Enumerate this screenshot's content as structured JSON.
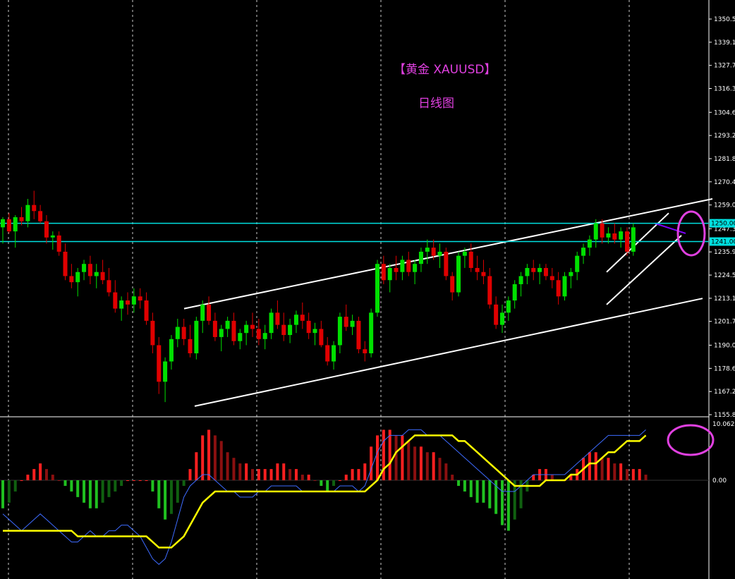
{
  "chart_data": {
    "type": "candlestick",
    "title": "【黄金 XAUUSD】",
    "subtitle": "日线图",
    "price_axis": {
      "labels": [
        "1350.50",
        "1339.10",
        "1327.70",
        "1316.30",
        "1304.60",
        "1293.20",
        "1281.80",
        "1270.40",
        "1259.00",
        "1247.30",
        "1235.90",
        "1224.50",
        "1213.10",
        "1201.70",
        "1190.00",
        "1178.60",
        "1167.20",
        "1155.80"
      ],
      "range": [
        1155.8,
        1350.5
      ]
    },
    "horizontal_levels": [
      {
        "value": 1250.0,
        "label": "1250.00",
        "color": "#00e0e0"
      },
      {
        "value": 1241.0,
        "label": "1241.00",
        "color": "#00e0e0"
      }
    ],
    "trend_channel": {
      "lower": [
        [
          276,
          1160
        ],
        [
          996,
          1213
        ]
      ],
      "upper": [
        [
          261,
          1208
        ],
        [
          1010,
          1262
        ]
      ]
    },
    "small_channel": {
      "lower": [
        [
          860,
          1210
        ],
        [
          966,
          1244
        ]
      ],
      "upper": [
        [
          860,
          1226
        ],
        [
          948,
          1255
        ]
      ]
    },
    "highlight_circles": [
      "price-latest",
      "macd-latest"
    ],
    "candles": [
      [
        1248,
        1253,
        1240,
        1252
      ],
      [
        1252,
        1255,
        1245,
        1246
      ],
      [
        1246,
        1254,
        1238,
        1253
      ],
      [
        1253,
        1258,
        1249,
        1251
      ],
      [
        1251,
        1262,
        1248,
        1259
      ],
      [
        1259,
        1266,
        1252,
        1256
      ],
      [
        1256,
        1259,
        1250,
        1251
      ],
      [
        1251,
        1254,
        1240,
        1243
      ],
      [
        1243,
        1246,
        1237,
        1244
      ],
      [
        1244,
        1246,
        1234,
        1236
      ],
      [
        1236,
        1240,
        1222,
        1224
      ],
      [
        1224,
        1230,
        1218,
        1221
      ],
      [
        1221,
        1228,
        1214,
        1226
      ],
      [
        1226,
        1232,
        1222,
        1230
      ],
      [
        1230,
        1234,
        1220,
        1224
      ],
      [
        1224,
        1230,
        1218,
        1226
      ],
      [
        1226,
        1232,
        1220,
        1222
      ],
      [
        1222,
        1228,
        1214,
        1216
      ],
      [
        1216,
        1222,
        1206,
        1208
      ],
      [
        1208,
        1214,
        1202,
        1212
      ],
      [
        1212,
        1216,
        1205,
        1210
      ],
      [
        1210,
        1218,
        1206,
        1214
      ],
      [
        1214,
        1218,
        1208,
        1212
      ],
      [
        1212,
        1216,
        1200,
        1202
      ],
      [
        1202,
        1206,
        1186,
        1190
      ],
      [
        1190,
        1194,
        1166,
        1172
      ],
      [
        1172,
        1184,
        1162,
        1182
      ],
      [
        1182,
        1195,
        1178,
        1193
      ],
      [
        1193,
        1203,
        1189,
        1199
      ],
      [
        1199,
        1203,
        1190,
        1193
      ],
      [
        1193,
        1200,
        1184,
        1186
      ],
      [
        1186,
        1204,
        1183,
        1202
      ],
      [
        1202,
        1212,
        1196,
        1210
      ],
      [
        1210,
        1214,
        1200,
        1202
      ],
      [
        1202,
        1206,
        1192,
        1194
      ],
      [
        1194,
        1200,
        1187,
        1198
      ],
      [
        1198,
        1204,
        1194,
        1202
      ],
      [
        1202,
        1206,
        1190,
        1192
      ],
      [
        1192,
        1198,
        1188,
        1196
      ],
      [
        1196,
        1202,
        1190,
        1200
      ],
      [
        1200,
        1206,
        1194,
        1198
      ],
      [
        1198,
        1203,
        1190,
        1193
      ],
      [
        1193,
        1200,
        1188,
        1196
      ],
      [
        1196,
        1208,
        1193,
        1206
      ],
      [
        1206,
        1212,
        1198,
        1200
      ],
      [
        1200,
        1206,
        1192,
        1195
      ],
      [
        1195,
        1203,
        1191,
        1200
      ],
      [
        1200,
        1207,
        1196,
        1205
      ],
      [
        1205,
        1211,
        1198,
        1202
      ],
      [
        1202,
        1206,
        1193,
        1196
      ],
      [
        1196,
        1201,
        1190,
        1198
      ],
      [
        1198,
        1202,
        1189,
        1190
      ],
      [
        1190,
        1194,
        1180,
        1182
      ],
      [
        1182,
        1192,
        1178,
        1190
      ],
      [
        1190,
        1206,
        1186,
        1204
      ],
      [
        1204,
        1210,
        1197,
        1199
      ],
      [
        1199,
        1205,
        1195,
        1202
      ],
      [
        1202,
        1204,
        1186,
        1188
      ],
      [
        1188,
        1192,
        1182,
        1186
      ],
      [
        1186,
        1208,
        1184,
        1206
      ],
      [
        1206,
        1232,
        1204,
        1230
      ],
      [
        1230,
        1234,
        1220,
        1222
      ],
      [
        1222,
        1230,
        1216,
        1228
      ],
      [
        1228,
        1234,
        1222,
        1226
      ],
      [
        1226,
        1234,
        1222,
        1232
      ],
      [
        1232,
        1236,
        1224,
        1226
      ],
      [
        1226,
        1232,
        1220,
        1230
      ],
      [
        1230,
        1238,
        1226,
        1236
      ],
      [
        1236,
        1242,
        1230,
        1238
      ],
      [
        1238,
        1242,
        1232,
        1234
      ],
      [
        1234,
        1240,
        1228,
        1236
      ],
      [
        1236,
        1238,
        1222,
        1224
      ],
      [
        1224,
        1226,
        1212,
        1216
      ],
      [
        1216,
        1236,
        1214,
        1234
      ],
      [
        1234,
        1238,
        1228,
        1236
      ],
      [
        1236,
        1240,
        1226,
        1228
      ],
      [
        1228,
        1234,
        1222,
        1226
      ],
      [
        1226,
        1232,
        1220,
        1224
      ],
      [
        1224,
        1228,
        1208,
        1210
      ],
      [
        1210,
        1214,
        1198,
        1200
      ],
      [
        1200,
        1210,
        1196,
        1206
      ],
      [
        1206,
        1214,
        1202,
        1212
      ],
      [
        1212,
        1222,
        1208,
        1220
      ],
      [
        1220,
        1226,
        1214,
        1224
      ],
      [
        1224,
        1230,
        1220,
        1228
      ],
      [
        1228,
        1232,
        1222,
        1226
      ],
      [
        1226,
        1230,
        1220,
        1228
      ],
      [
        1228,
        1230,
        1222,
        1224
      ],
      [
        1224,
        1228,
        1218,
        1222
      ],
      [
        1222,
        1226,
        1210,
        1214
      ],
      [
        1214,
        1226,
        1212,
        1224
      ],
      [
        1224,
        1228,
        1218,
        1226
      ],
      [
        1226,
        1236,
        1222,
        1234
      ],
      [
        1234,
        1240,
        1230,
        1238
      ],
      [
        1238,
        1244,
        1234,
        1242
      ],
      [
        1242,
        1252,
        1238,
        1250
      ],
      [
        1250,
        1252,
        1240,
        1243
      ],
      [
        1243,
        1248,
        1240,
        1245
      ],
      [
        1245,
        1250,
        1240,
        1242
      ],
      [
        1242,
        1248,
        1238,
        1246
      ],
      [
        1246,
        1248,
        1234,
        1236
      ],
      [
        1236,
        1250,
        1234,
        1248
      ]
    ],
    "macd_axis": {
      "labels": [
        "10.0622",
        "0.00"
      ],
      "range": [
        -17.3,
        10.06
      ]
    },
    "macd_hist": [
      -5,
      -4,
      -2,
      0,
      1,
      2,
      3,
      2,
      1,
      0,
      -1,
      -2,
      -3,
      -4,
      -5,
      -5,
      -4,
      -3,
      -2,
      -1,
      0,
      0,
      0,
      0,
      -2,
      -5,
      -7,
      -6,
      -4,
      -1,
      2,
      5,
      8,
      9,
      8,
      7,
      5,
      4,
      3,
      3,
      2,
      2,
      2,
      2,
      3,
      3,
      2,
      2,
      1,
      1,
      0,
      -1,
      -2,
      -1,
      0,
      1,
      2,
      2,
      3,
      6,
      8,
      9,
      9,
      8,
      8,
      7,
      6,
      6,
      5,
      5,
      4,
      3,
      1,
      -1,
      -2,
      -3,
      -4,
      -4,
      -5,
      -6,
      -8,
      -9,
      -7,
      -5,
      -2,
      1,
      2,
      2,
      1,
      0,
      0,
      1,
      2,
      4,
      5,
      5,
      4,
      4,
      3,
      3,
      2,
      2,
      2,
      1
    ],
    "macd_line": [
      -6,
      -7,
      -8,
      -9,
      -8,
      -7,
      -6,
      -7,
      -8,
      -9,
      -10,
      -11,
      -11,
      -10,
      -9,
      -10,
      -10,
      -9,
      -9,
      -8,
      -8,
      -9,
      -10,
      -12,
      -14,
      -15,
      -14,
      -11,
      -7,
      -3,
      -1,
      0,
      1,
      1,
      0,
      -1,
      -2,
      -2,
      -3,
      -3,
      -3,
      -2,
      -2,
      -1,
      -1,
      -1,
      -1,
      -1,
      -2,
      -2,
      -2,
      -2,
      -2,
      -2,
      -1,
      -1,
      -1,
      -2,
      -1,
      2,
      5,
      7,
      8,
      8,
      8,
      9,
      9,
      9,
      8,
      8,
      8,
      7,
      6,
      5,
      4,
      3,
      2,
      1,
      0,
      -1,
      -2,
      -2,
      -2,
      -1,
      0,
      1,
      1,
      1,
      1,
      1,
      1,
      2,
      3,
      4,
      5,
      6,
      7,
      8,
      8,
      8,
      8,
      8,
      8,
      9
    ],
    "signal_line": [
      -9,
      -9,
      -9,
      -9,
      -9,
      -9,
      -9,
      -9,
      -9,
      -9,
      -9,
      -9,
      -10,
      -10,
      -10,
      -10,
      -10,
      -10,
      -10,
      -10,
      -10,
      -10,
      -10,
      -10,
      -11,
      -12,
      -12,
      -12,
      -11,
      -10,
      -8,
      -6,
      -4,
      -3,
      -2,
      -2,
      -2,
      -2,
      -2,
      -2,
      -2,
      -2,
      -2,
      -2,
      -2,
      -2,
      -2,
      -2,
      -2,
      -2,
      -2,
      -2,
      -2,
      -2,
      -2,
      -2,
      -2,
      -2,
      -2,
      -1,
      0,
      2,
      3,
      5,
      6,
      7,
      8,
      8,
      8,
      8,
      8,
      8,
      8,
      7,
      7,
      6,
      5,
      4,
      3,
      2,
      1,
      0,
      -1,
      -1,
      -1,
      -1,
      -1,
      0,
      0,
      0,
      0,
      1,
      1,
      2,
      3,
      3,
      4,
      5,
      5,
      6,
      7,
      7,
      7,
      8
    ],
    "colors": {
      "bull": "#00e000",
      "bear": "#e00000",
      "grid": "#ffffff",
      "level": "#00e0e0",
      "channel": "#ffffff",
      "macd": "#3d6bff",
      "signal": "#ffff00",
      "circle": "#e040e0",
      "small_channel_top": "#8000ff"
    },
    "grid": true
  }
}
